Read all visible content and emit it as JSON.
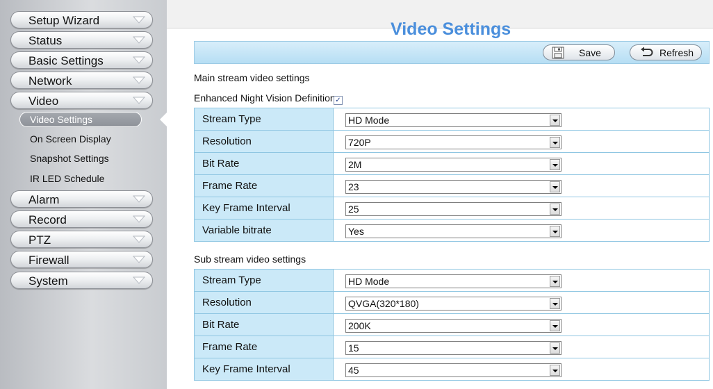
{
  "sidebar": {
    "menu": [
      {
        "label": "Setup Wizard"
      },
      {
        "label": "Status"
      },
      {
        "label": "Basic Settings"
      },
      {
        "label": "Network"
      },
      {
        "label": "Video"
      }
    ],
    "video_submenu": [
      {
        "label": "Video Settings",
        "active": true
      },
      {
        "label": "On Screen Display"
      },
      {
        "label": "Snapshot Settings"
      },
      {
        "label": "IR LED Schedule"
      }
    ],
    "menu_bottom": [
      {
        "label": "Alarm"
      },
      {
        "label": "Record"
      },
      {
        "label": "PTZ"
      },
      {
        "label": "Firewall"
      },
      {
        "label": "System"
      }
    ]
  },
  "page": {
    "title": "Video Settings",
    "save_label": "Save",
    "refresh_label": "Refresh"
  },
  "main_stream": {
    "heading": "Main stream video settings",
    "night_vision_label": "Enhanced Night Vision Definition",
    "night_vision_checked": true,
    "rows": [
      {
        "label": "Stream Type",
        "value": "HD Mode"
      },
      {
        "label": "Resolution",
        "value": "720P"
      },
      {
        "label": "Bit Rate",
        "value": "2M"
      },
      {
        "label": "Frame Rate",
        "value": "23"
      },
      {
        "label": "Key Frame Interval",
        "value": "25"
      },
      {
        "label": "Variable bitrate",
        "value": "Yes"
      }
    ]
  },
  "sub_stream": {
    "heading": "Sub stream video settings",
    "rows": [
      {
        "label": "Stream Type",
        "value": "HD Mode"
      },
      {
        "label": "Resolution",
        "value": "QVGA(320*180)"
      },
      {
        "label": "Bit Rate",
        "value": "200K"
      },
      {
        "label": "Frame Rate",
        "value": "15"
      },
      {
        "label": "Key Frame Interval",
        "value": "45"
      }
    ]
  },
  "colors": {
    "title": "#4b8fdc",
    "label_cell": "#cbe9f8",
    "toolbar": "#c6e6f7"
  }
}
